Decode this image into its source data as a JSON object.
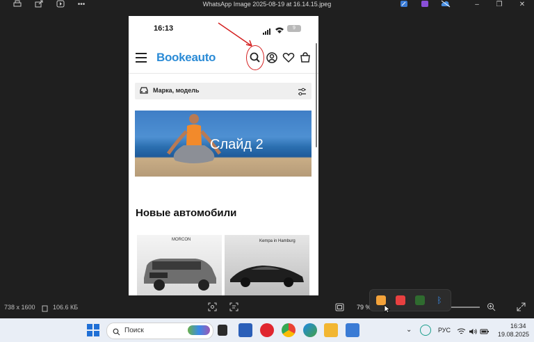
{
  "window": {
    "title": "WhatsApp Image 2025-08-19 at 16.14.15.jpeg"
  },
  "toolbar_left": [
    "print-icon",
    "share-icon",
    "slideshow-icon",
    "more-icon"
  ],
  "window_controls": [
    "minimize",
    "maximize",
    "close"
  ],
  "phone": {
    "status_time": "16:13",
    "battery": "9",
    "logo": "Bookeauto",
    "search_placeholder": "Марка, модель",
    "banner_text": "Слайд 2",
    "section_title": "Новые автомобили",
    "car_cards": [
      {
        "dealer": "MORCON"
      },
      {
        "dealer": "Kempa in Hamburg"
      }
    ]
  },
  "viewer_bar": {
    "dimensions": "738 x 1600",
    "file_size": "106.6 КБ",
    "zoom": "79 %"
  },
  "tray_popup_icons": [
    "app-orange-icon",
    "record-icon",
    "nvidia-icon",
    "bluetooth-icon"
  ],
  "taskbar": {
    "search_label": "Поиск",
    "language": "РУС",
    "time": "16:34",
    "date": "19.08.2025"
  },
  "colors": {
    "brand_blue": "#2b8bd6",
    "annotation_red": "#d42020",
    "taskbar_bg": "#e9eef6"
  }
}
